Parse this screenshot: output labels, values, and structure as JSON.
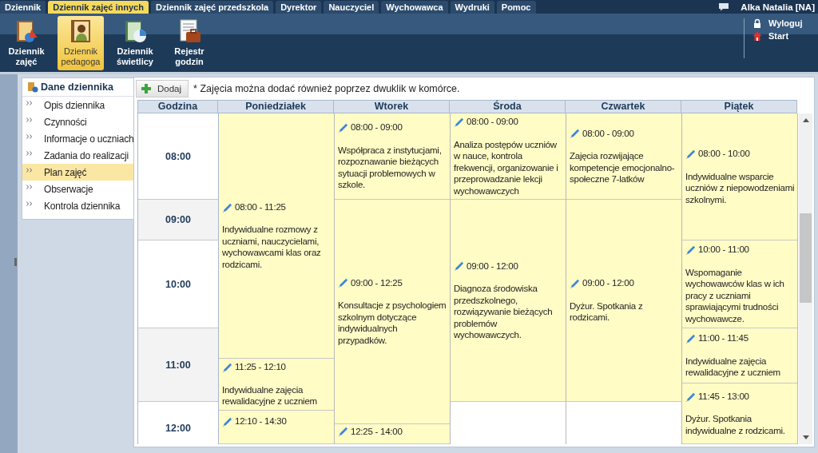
{
  "menu_tabs": [
    {
      "label": "Dziennik",
      "selected": false
    },
    {
      "label": "Dziennik zajęć innych",
      "selected": true
    },
    {
      "label": "Dziennik zajęć przedszkola",
      "selected": false
    },
    {
      "label": "Dyrektor",
      "selected": false
    },
    {
      "label": "Nauczyciel",
      "selected": false
    },
    {
      "label": "Wychowawca",
      "selected": false
    },
    {
      "label": "Wydruki",
      "selected": false
    },
    {
      "label": "Pomoc",
      "selected": false
    }
  ],
  "user": "Alka Natalia [NA]",
  "toolbar": [
    {
      "label": "Dziennik\nzajęć",
      "kind": "journal",
      "selected": false
    },
    {
      "label": "Dziennik\npedagoga",
      "kind": "teacher",
      "selected": true
    },
    {
      "label": "Dziennik\nświetlicy",
      "kind": "daycare",
      "selected": false
    },
    {
      "label": "Rejestr\ngodzin",
      "kind": "register",
      "selected": false
    }
  ],
  "session_links": [
    {
      "label": "Wyloguj",
      "kind": "logout"
    },
    {
      "label": "Start",
      "kind": "home"
    }
  ],
  "sidebar": {
    "title": "Dane dziennika",
    "items": [
      {
        "label": "Opis dziennika",
        "selected": false
      },
      {
        "label": "Czynności",
        "selected": false
      },
      {
        "label": "Informacje o uczniach",
        "selected": false
      },
      {
        "label": "Zadania do realizacji",
        "selected": false
      },
      {
        "label": "Plan zajęć",
        "selected": true
      },
      {
        "label": "Obserwacje",
        "selected": false
      },
      {
        "label": "Kontrola dziennika",
        "selected": false
      }
    ]
  },
  "add_button": "Dodaj",
  "note": "* Zajęcia można dodać również poprzez dwuklik w komórce.",
  "calendar": {
    "columns": [
      "Godzina",
      "Poniedziałek",
      "Wtorek",
      "Środa",
      "Czwartek",
      "Piątek"
    ],
    "hours": [
      "08:00",
      "09:00",
      "10:00",
      "11:00",
      "12:00"
    ],
    "days": [
      {
        "events": [
          {
            "time": "08:00 - 11:25",
            "description": "Indywidualne rozmowy z uczniami, nauczycielami, wychowawcami klas oraz rodzicami."
          },
          {
            "time": "11:25 - 12:10",
            "description": "Indywidualne zajęcia rewalidacyjne z uczniem"
          },
          {
            "time": "12:10 - 14:30"
          }
        ]
      },
      {
        "events": [
          {
            "time": "08:00 - 09:00",
            "description": "Współpraca z instytucjami, rozpoznawanie bieżących sytuacji problemowych w szkole."
          },
          {
            "time": "09:00 - 12:25",
            "description": "Konsultacje z psychologiem szkolnym dotyczące indywidualnych przypadków."
          },
          {
            "time": "12:25 - 14:00"
          }
        ]
      },
      {
        "events": [
          {
            "time": "08:00 - 09:00",
            "description": "Analiza postępów uczniów w nauce, kontrola frekwencji, organizowanie i przeprowadzanie lekcji wychowawczych"
          },
          {
            "time": "09:00 - 12:00",
            "description": "Diagnoza środowiska przedszkolnego, rozwiązywanie bieżących problemów wychowawczych."
          }
        ]
      },
      {
        "events": [
          {
            "time": "08:00 - 09:00",
            "description": "Zajęcia rozwijające kompetencje emocjonalno-społeczne 7-latków"
          },
          {
            "time": "09:00 - 12:00",
            "description": "Dyżur. Spotkania z rodzicami."
          }
        ]
      },
      {
        "events": [
          {
            "time": "08:00 - 10:00",
            "description": "Indywidualne wsparcie uczniów z niepowodzeniami szkolnymi."
          },
          {
            "time": "10:00 - 11:00",
            "description": "Wspomaganie wychowawców klas w ich pracy z uczniami sprawiającymi trudności wychowawcze."
          },
          {
            "time": "11:00 - 11:45",
            "description": "Indywidualne zajęcia rewalidacyjne z uczniem"
          },
          {
            "time": "11:45 - 13:00",
            "description": "Dyżur. Spotkania indywidualne z rodzicami."
          }
        ]
      }
    ]
  }
}
